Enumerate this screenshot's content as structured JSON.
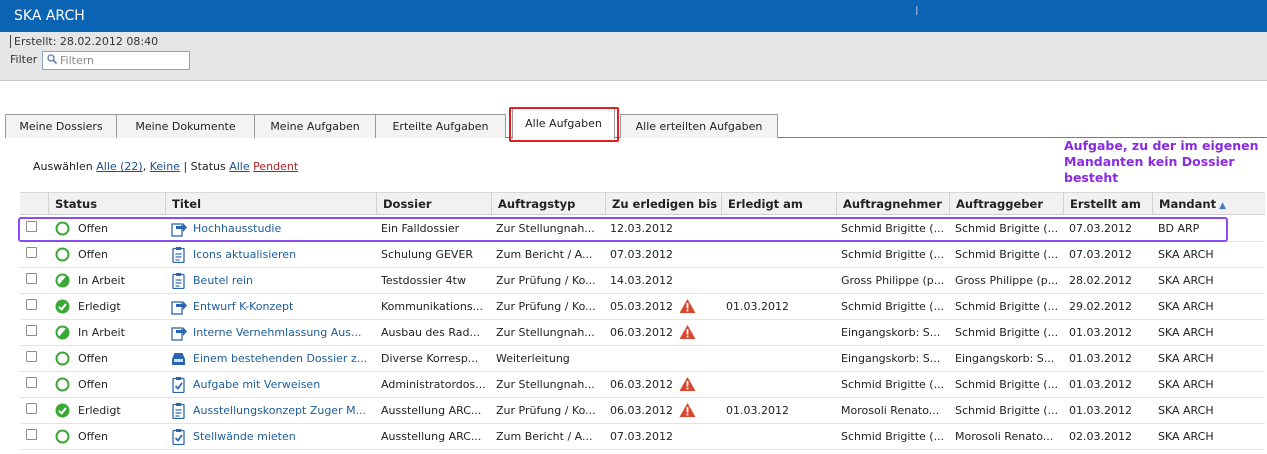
{
  "window": {
    "title": "SKA ARCH",
    "cursor_glyph": "I"
  },
  "info": {
    "created": "Erstellt: 28.02.2012 08:40",
    "filter_label": "Filter",
    "filter_placeholder": "Filtern"
  },
  "tabs": [
    {
      "label": "Meine Dossiers"
    },
    {
      "label": "Meine Dokumente"
    },
    {
      "label": "Meine Aufgaben"
    },
    {
      "label": "Erteilte Aufgaben"
    },
    {
      "label": "Alle Aufgaben"
    },
    {
      "label": "Alle erteilten Aufgaben"
    }
  ],
  "active_tab": "Alle Aufgaben",
  "selection": {
    "prefix": "Auswählen",
    "all": "Alle (22)",
    "comma": ",",
    "none": "Keine",
    "separator": "| Status",
    "status_all": "Alle",
    "status_pending": "Pendent"
  },
  "annotation": "Aufgabe, zu der im eigenen Mandanten kein Dossier besteht",
  "table": {
    "columns": [
      "Status",
      "Titel",
      "Dossier",
      "Auftragstyp",
      "Zu erledigen bis",
      "Erledigt am",
      "Auftragnehmer",
      "Auftraggeber",
      "Erstellt am",
      "Mandant"
    ],
    "sort_indicator": "▲",
    "rows": [
      {
        "status": "Offen",
        "status_icon": "open-circle-icon",
        "task_icon": "task-forward-icon",
        "title": "Hochhausstudie",
        "dossier": "Ein Falldossier",
        "type": "Zur Stellungnah...",
        "due": "12.03.2012",
        "overdue": false,
        "done": "",
        "assignee": "Schmid Brigitte (...",
        "issuer": "Schmid Brigitte (...",
        "created": "07.03.2012",
        "client": "BD ARP"
      },
      {
        "status": "Offen",
        "status_icon": "open-circle-icon",
        "task_icon": "task-clipboard-icon",
        "title": "Icons aktualisieren",
        "dossier": "Schulung GEVER",
        "type": "Zum Bericht / A...",
        "due": "07.03.2012",
        "overdue": false,
        "done": "",
        "assignee": "Schmid Brigitte (...",
        "issuer": "Schmid Brigitte (...",
        "created": "07.03.2012",
        "client": "SKA ARCH"
      },
      {
        "status": "In Arbeit",
        "status_icon": "in-progress-icon",
        "task_icon": "task-clipboard-icon",
        "title": "Beutel rein",
        "dossier": "Testdossier 4tw",
        "type": "Zur Prüfung / Ko...",
        "due": "14.03.2012",
        "overdue": false,
        "done": "",
        "assignee": "Gross Philippe (p...",
        "issuer": "Gross Philippe (p...",
        "created": "28.02.2012",
        "client": "SKA ARCH"
      },
      {
        "status": "Erledigt",
        "status_icon": "done-check-icon",
        "task_icon": "task-forward-icon",
        "title": "Entwurf K-Konzept",
        "dossier": "Kommunikations...",
        "type": "Zur Prüfung / Ko...",
        "due": "05.03.2012",
        "overdue": true,
        "done": "01.03.2012",
        "assignee": "Schmid Brigitte (...",
        "issuer": "Schmid Brigitte (...",
        "created": "29.02.2012",
        "client": "SKA ARCH"
      },
      {
        "status": "In Arbeit",
        "status_icon": "in-progress-icon",
        "task_icon": "task-forward-icon",
        "title": "Interne Vernehmlassung Aus...",
        "dossier": "Ausbau des Rad...",
        "type": "Zur Stellungnah...",
        "due": "06.03.2012",
        "overdue": true,
        "done": "",
        "assignee": "Eingangskorb: S...",
        "issuer": "Schmid Brigitte (...",
        "created": "01.03.2012",
        "client": "SKA ARCH"
      },
      {
        "status": "Offen",
        "status_icon": "open-circle-icon",
        "task_icon": "task-inbox-icon",
        "title": "Einem bestehenden Dossier z...",
        "dossier": "Diverse Korresp...",
        "type": "Weiterleitung",
        "due": "",
        "overdue": false,
        "done": "",
        "assignee": "Eingangskorb: S...",
        "issuer": "Eingangskorb: S...",
        "created": "01.03.2012",
        "client": "SKA ARCH"
      },
      {
        "status": "Offen",
        "status_icon": "open-circle-icon",
        "task_icon": "task-check-clipboard-icon",
        "title": "Aufgabe mit Verweisen",
        "dossier": "Administratordos...",
        "type": "Zur Stellungnah...",
        "due": "06.03.2012",
        "overdue": true,
        "done": "",
        "assignee": "Schmid Brigitte (...",
        "issuer": "Schmid Brigitte (...",
        "created": "01.03.2012",
        "client": "SKA ARCH"
      },
      {
        "status": "Erledigt",
        "status_icon": "done-check-icon",
        "task_icon": "task-clipboard-icon",
        "title": "Ausstellungskonzept Zuger M...",
        "dossier": "Ausstellung ARC...",
        "type": "Zur Prüfung / Ko...",
        "due": "06.03.2012",
        "overdue": true,
        "done": "01.03.2012",
        "assignee": "Morosoli Renato...",
        "issuer": "Schmid Brigitte (...",
        "created": "01.03.2012",
        "client": "SKA ARCH"
      },
      {
        "status": "Offen",
        "status_icon": "open-circle-icon",
        "task_icon": "task-check-clipboard-icon",
        "title": "Stellwände mieten",
        "dossier": "Ausstellung ARC...",
        "type": "Zum Bericht / A...",
        "due": "07.03.2012",
        "overdue": false,
        "done": "",
        "assignee": "Schmid Brigitte (...",
        "issuer": "Morosoli Renato...",
        "created": "02.03.2012",
        "client": "SKA ARCH"
      }
    ]
  },
  "colors": {
    "titlebar": "#0a63b3",
    "link": "#1c5d99",
    "status_green": "#3aa935",
    "warning": "#d9462b",
    "annotation": "#8a2be2",
    "tab_highlight": "#e0201f"
  }
}
